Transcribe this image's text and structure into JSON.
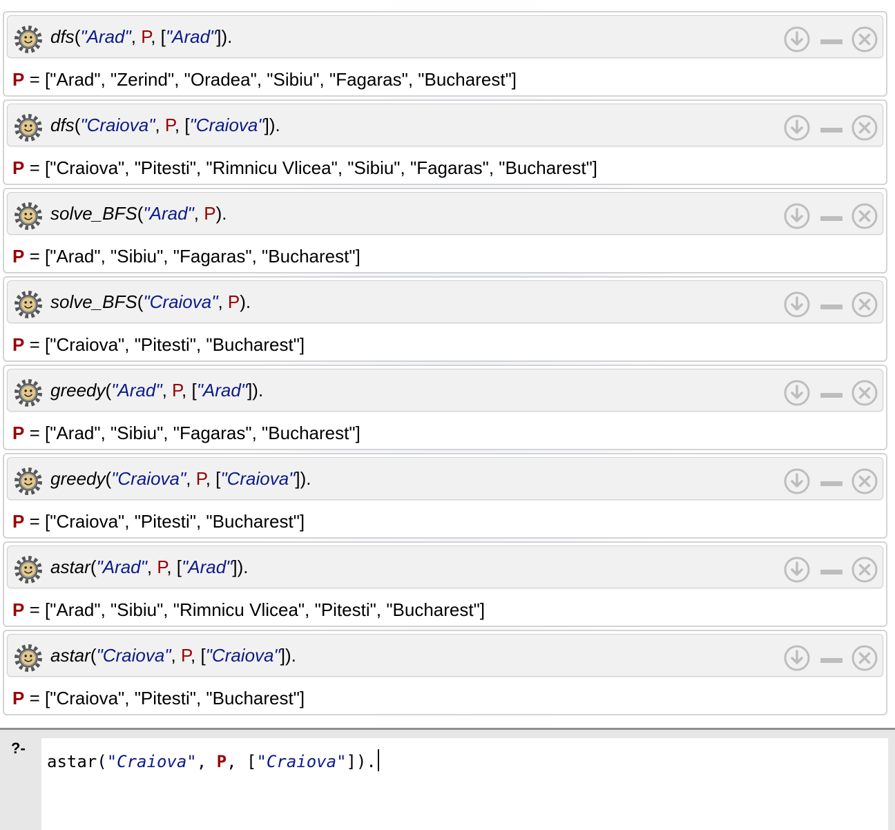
{
  "cells": [
    {
      "query": [
        {
          "t": "dfs",
          "k": "fn"
        },
        {
          "t": "(",
          "k": "p"
        },
        {
          "t": "\"Arad\"",
          "k": "str"
        },
        {
          "t": ", ",
          "k": "p"
        },
        {
          "t": "P",
          "k": "var"
        },
        {
          "t": ", [",
          "k": "p"
        },
        {
          "t": "\"Arad\"",
          "k": "str"
        },
        {
          "t": "]).",
          "k": "p"
        }
      ],
      "answer_var": "P",
      "answer_value": "= [\"Arad\", \"Zerind\", \"Oradea\", \"Sibiu\", \"Fagaras\", \"Bucharest\"]"
    },
    {
      "query": [
        {
          "t": "dfs",
          "k": "fn"
        },
        {
          "t": "(",
          "k": "p"
        },
        {
          "t": "\"Craiova\"",
          "k": "str"
        },
        {
          "t": ", ",
          "k": "p"
        },
        {
          "t": "P",
          "k": "var"
        },
        {
          "t": ", [",
          "k": "p"
        },
        {
          "t": "\"Craiova\"",
          "k": "str"
        },
        {
          "t": "]).",
          "k": "p"
        }
      ],
      "answer_var": "P",
      "answer_value": "= [\"Craiova\", \"Pitesti\", \"Rimnicu Vlicea\", \"Sibiu\", \"Fagaras\", \"Bucharest\"]"
    },
    {
      "query": [
        {
          "t": "solve_BFS",
          "k": "fn"
        },
        {
          "t": "(",
          "k": "p"
        },
        {
          "t": "\"Arad\"",
          "k": "str"
        },
        {
          "t": ", ",
          "k": "p"
        },
        {
          "t": "P",
          "k": "var"
        },
        {
          "t": ").",
          "k": "p"
        }
      ],
      "answer_var": "P",
      "answer_value": "= [\"Arad\", \"Sibiu\", \"Fagaras\", \"Bucharest\"]"
    },
    {
      "query": [
        {
          "t": "solve_BFS",
          "k": "fn"
        },
        {
          "t": "(",
          "k": "p"
        },
        {
          "t": "\"Craiova\"",
          "k": "str"
        },
        {
          "t": ", ",
          "k": "p"
        },
        {
          "t": "P",
          "k": "var"
        },
        {
          "t": ").",
          "k": "p"
        }
      ],
      "answer_var": "P",
      "answer_value": "= [\"Craiova\", \"Pitesti\", \"Bucharest\"]"
    },
    {
      "query": [
        {
          "t": "greedy",
          "k": "fn"
        },
        {
          "t": "(",
          "k": "p"
        },
        {
          "t": "\"Arad\"",
          "k": "str"
        },
        {
          "t": ", ",
          "k": "p"
        },
        {
          "t": "P",
          "k": "var"
        },
        {
          "t": ", [",
          "k": "p"
        },
        {
          "t": "\"Arad\"",
          "k": "str"
        },
        {
          "t": "]).",
          "k": "p"
        }
      ],
      "answer_var": "P",
      "answer_value": "= [\"Arad\", \"Sibiu\", \"Fagaras\", \"Bucharest\"]"
    },
    {
      "query": [
        {
          "t": "greedy",
          "k": "fn"
        },
        {
          "t": "(",
          "k": "p"
        },
        {
          "t": "\"Craiova\"",
          "k": "str"
        },
        {
          "t": ", ",
          "k": "p"
        },
        {
          "t": "P",
          "k": "var"
        },
        {
          "t": ", [",
          "k": "p"
        },
        {
          "t": "\"Craiova\"",
          "k": "str"
        },
        {
          "t": "]).",
          "k": "p"
        }
      ],
      "answer_var": "P",
      "answer_value": "= [\"Craiova\", \"Pitesti\", \"Bucharest\"]"
    },
    {
      "query": [
        {
          "t": "astar",
          "k": "fn"
        },
        {
          "t": "(",
          "k": "p"
        },
        {
          "t": "\"Arad\"",
          "k": "str"
        },
        {
          "t": ", ",
          "k": "p"
        },
        {
          "t": "P",
          "k": "var"
        },
        {
          "t": ", [",
          "k": "p"
        },
        {
          "t": "\"Arad\"",
          "k": "str"
        },
        {
          "t": "]).",
          "k": "p"
        }
      ],
      "answer_var": "P",
      "answer_value": "= [\"Arad\", \"Sibiu\", \"Rimnicu Vlicea\", \"Pitesti\", \"Bucharest\"]"
    },
    {
      "query": [
        {
          "t": "astar",
          "k": "fn"
        },
        {
          "t": "(",
          "k": "p"
        },
        {
          "t": "\"Craiova\"",
          "k": "str"
        },
        {
          "t": ", ",
          "k": "p"
        },
        {
          "t": "P",
          "k": "var"
        },
        {
          "t": ", [",
          "k": "p"
        },
        {
          "t": "\"Craiova\"",
          "k": "str"
        },
        {
          "t": "]).",
          "k": "p"
        }
      ],
      "answer_var": "P",
      "answer_value": "= [\"Craiova\", \"Pitesti\", \"Bucharest\"]"
    }
  ],
  "cell_icons": {
    "query": "gear-icon",
    "download": "download-icon",
    "minimize": "minimize-icon",
    "close": "close-icon"
  },
  "prompt": {
    "label": "?-",
    "query": [
      {
        "t": "astar(",
        "k": "p"
      },
      {
        "t": "\"Craiova\"",
        "k": "str"
      },
      {
        "t": ", ",
        "k": "p"
      },
      {
        "t": "P",
        "k": "var"
      },
      {
        "t": ", [",
        "k": "p"
      },
      {
        "t": "\"Craiova\"",
        "k": "str"
      },
      {
        "t": "]).",
        "k": "p"
      }
    ]
  },
  "colors": {
    "string": "#0a1a8a",
    "variable": "#9a0000",
    "icon_gray": "#bdbdbd"
  }
}
